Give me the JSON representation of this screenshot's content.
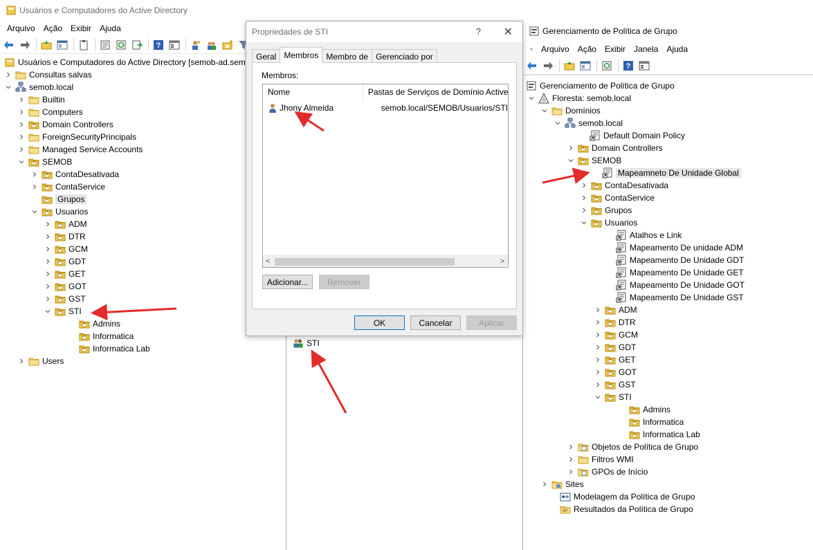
{
  "left_window": {
    "title": "Usuários e Computadores do Active Directory",
    "menu": [
      "Arquivo",
      "Ação",
      "Exibir",
      "Ajuda"
    ],
    "tree": [
      {
        "label": "Usuários e Computadores do Active Directory [semob-ad.semob.local]"
      },
      {
        "label": "Consultas salvas"
      },
      {
        "label": "semob.local"
      },
      {
        "label": "Builtin"
      },
      {
        "label": "Computers"
      },
      {
        "label": "Domain Controllers"
      },
      {
        "label": "ForeignSecurityPrincipals"
      },
      {
        "label": "Managed Service Accounts"
      },
      {
        "label": "SEMOB"
      },
      {
        "label": "ContaDesativada"
      },
      {
        "label": "ContaService"
      },
      {
        "label": "Grupos"
      },
      {
        "label": "Usuarios"
      },
      {
        "label": "ADM"
      },
      {
        "label": "DTR"
      },
      {
        "label": "GCM"
      },
      {
        "label": "GDT"
      },
      {
        "label": "GET"
      },
      {
        "label": "GOT"
      },
      {
        "label": "GST"
      },
      {
        "label": "STI"
      },
      {
        "label": "Admins"
      },
      {
        "label": "Informatica"
      },
      {
        "label": "Informatica Lab"
      },
      {
        "label": "Users"
      }
    ]
  },
  "middle_pane": {
    "group_item": "STI"
  },
  "dialog": {
    "title": "Propriedades de STI",
    "help_glyph": "?",
    "close_glyph": "✕",
    "tabs": [
      "Geral",
      "Membros",
      "Membro de",
      "Gerenciado por"
    ],
    "members_label": "Membros:",
    "columns": [
      "Nome",
      "Pastas de Serviços de Domínio Active Directory"
    ],
    "members": [
      {
        "name": "Jhony Almeida",
        "folder": "semob.local/SEMOB/Usuarios/STI"
      }
    ],
    "add_button": "Adicionar...",
    "remove_button": "Remover",
    "ok_button": "OK",
    "cancel_button": "Cancelar",
    "apply_button": "Aplicar"
  },
  "right_window": {
    "title": "Gerenciamento de Política de Grupo",
    "menu": [
      "Arquivo",
      "Ação",
      "Exibir",
      "Janela",
      "Ajuda"
    ],
    "tree": [
      {
        "label": "Gerenciamento de Política de Grupo"
      },
      {
        "label": "Floresta: semob.local"
      },
      {
        "label": "Domínios"
      },
      {
        "label": "semob.local"
      },
      {
        "label": "Default Domain Policy"
      },
      {
        "label": "Domain Controllers"
      },
      {
        "label": "SEMOB"
      },
      {
        "label": "Mapeamneto De Unidade Global"
      },
      {
        "label": "ContaDesativada"
      },
      {
        "label": "ContaService"
      },
      {
        "label": "Grupos"
      },
      {
        "label": "Usuarios"
      },
      {
        "label": "Atalhos e Link"
      },
      {
        "label": "Mapeamento De unidade ADM"
      },
      {
        "label": "Mapeamento De Unidade GDT"
      },
      {
        "label": "Mapeamento De Unidade GET"
      },
      {
        "label": "Mapeamento De Unidade GOT"
      },
      {
        "label": "Mapeamento De Unidade GST"
      },
      {
        "label": "ADM"
      },
      {
        "label": "DTR"
      },
      {
        "label": "GCM"
      },
      {
        "label": "GDT"
      },
      {
        "label": "GET"
      },
      {
        "label": "GOT"
      },
      {
        "label": "GST"
      },
      {
        "label": "STI"
      },
      {
        "label": "Admins"
      },
      {
        "label": "Informatica"
      },
      {
        "label": "Informatica Lab"
      },
      {
        "label": "Objetos de Política de Grupo"
      },
      {
        "label": "Filtros WMI"
      },
      {
        "label": "GPOs de Início"
      },
      {
        "label": "Sites"
      },
      {
        "label": "Modelagem da Política de Grupo"
      },
      {
        "label": "Resultados da Política de Grupo"
      }
    ]
  },
  "colors": {
    "annotation_arrow": "#e32b2b",
    "folder": "#f2c94c",
    "folder_dark": "#d6a21f",
    "selection": "#e5e5e5"
  }
}
